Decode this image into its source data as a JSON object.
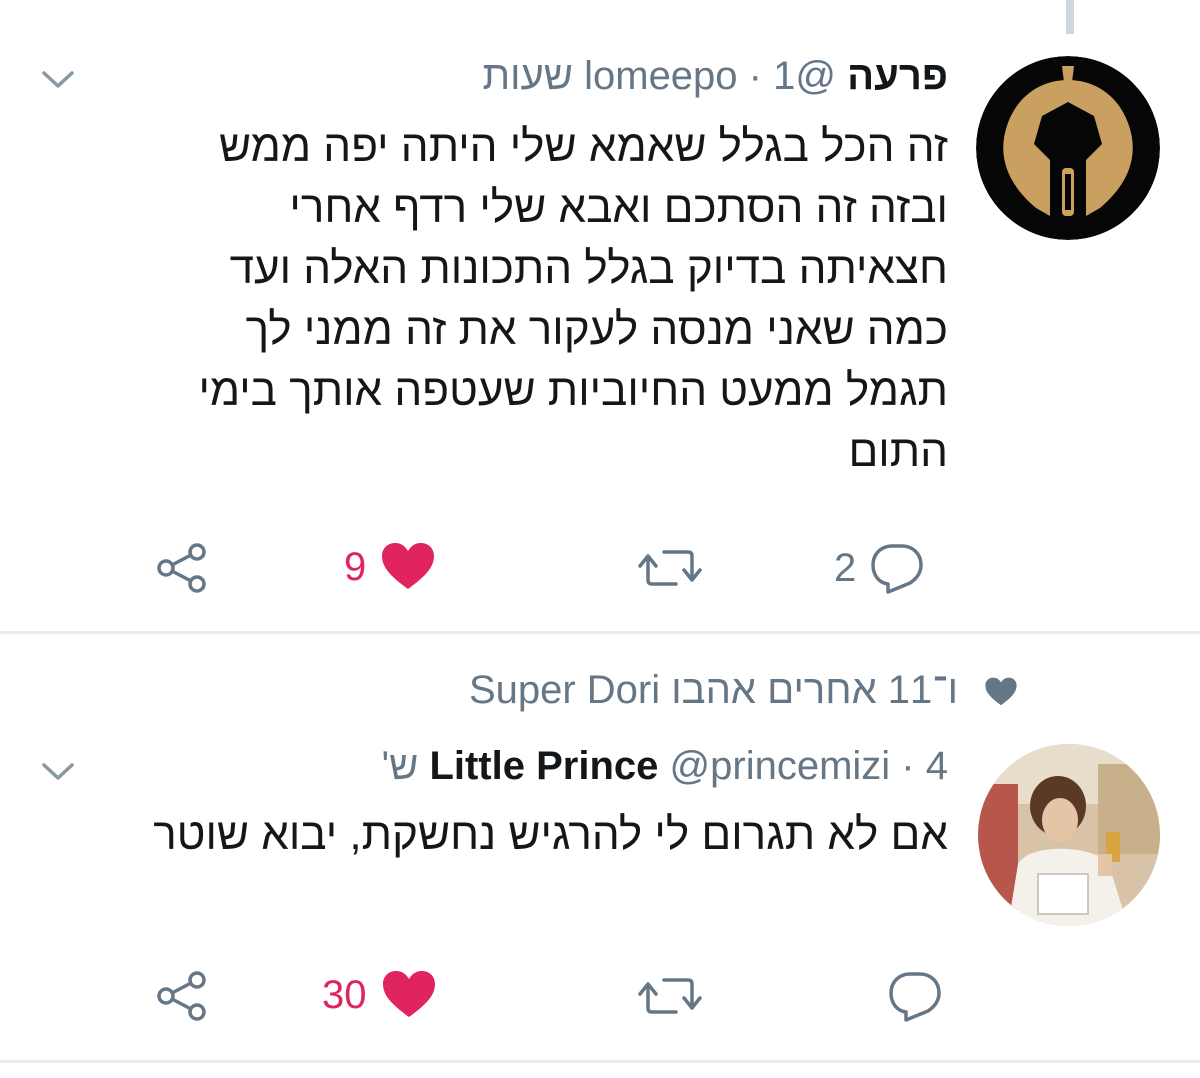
{
  "tweet1": {
    "name": "פרעה",
    "handle": "@lomeepo",
    "separator": "·",
    "time": "1 שעות",
    "text_lines": [
      "זה הכל בגלל שאמא שלי היתה יפה ממש",
      "ובזה זה הסתכם ואבא שלי רדף אחרי",
      "חצאיתה בדיוק בגלל התכונות האלה ועד",
      "כמה שאני מנסה לעקור את זה ממני לך",
      "תגמל ממעט החיוביות שעטפה אותך בימי",
      "התום"
    ],
    "replies": "2",
    "likes": "9"
  },
  "social_context": {
    "text": "ו־11 אחרים אהבו Super Dori"
  },
  "tweet2": {
    "name": "Little Prince",
    "handle": "@princemizi",
    "separator": "·",
    "time": "4 ש'",
    "text": "אם לא תגרום לי להרגיש נחשקת, יבוא שוטר",
    "likes": "30"
  },
  "colors": {
    "grey": "#657786",
    "like_red": "#e0245e",
    "divider": "#e6ecf0",
    "avatar_gold": "#c9a060"
  },
  "icons": {
    "chevron": "chevron-down-icon",
    "reply": "reply-icon",
    "retweet": "retweet-icon",
    "like": "heart-icon",
    "share": "share-icon"
  }
}
